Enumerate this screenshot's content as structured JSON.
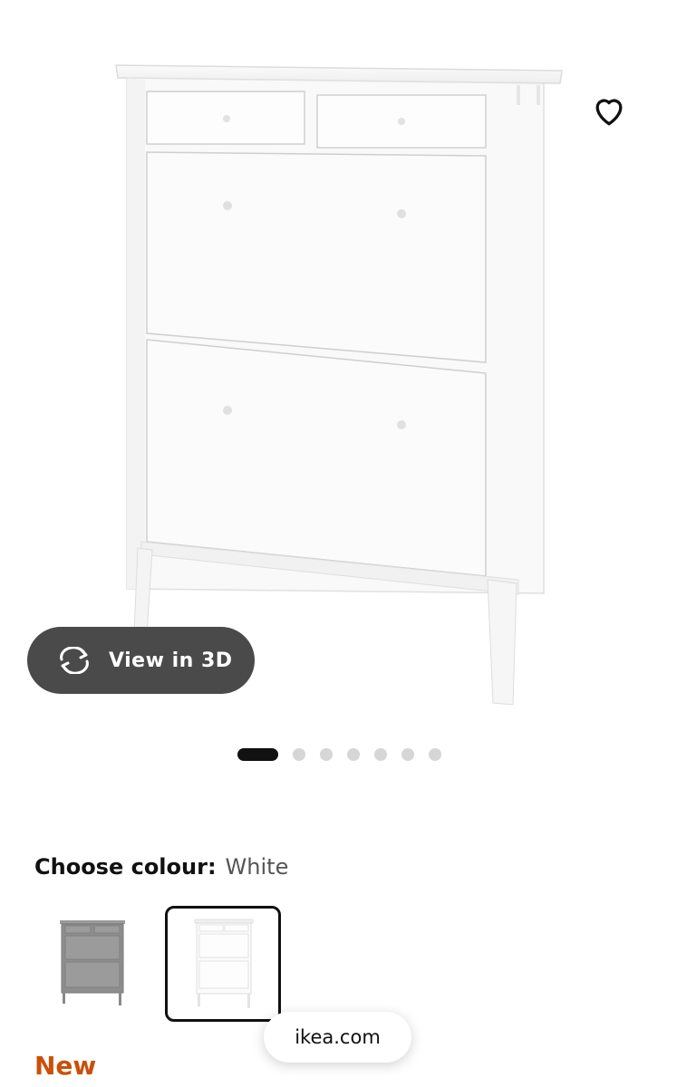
{
  "hero": {
    "image_desc": "white shoe cabinet with 2 small drawers and 2 tilt-out compartments"
  },
  "favorite": {
    "icon": "heart-outline-icon"
  },
  "view3d": {
    "label": "View in 3D",
    "icon": "rotate-3d-icon"
  },
  "carousel": {
    "total": 7,
    "active_index": 0
  },
  "colour": {
    "label": "Choose colour:",
    "selected": "White",
    "options": [
      {
        "name": "grey",
        "selected": false
      },
      {
        "name": "white",
        "selected": true
      }
    ]
  },
  "browser": {
    "url": "ikea.com"
  },
  "badge": {
    "label": "New",
    "color": "#ca5008"
  }
}
